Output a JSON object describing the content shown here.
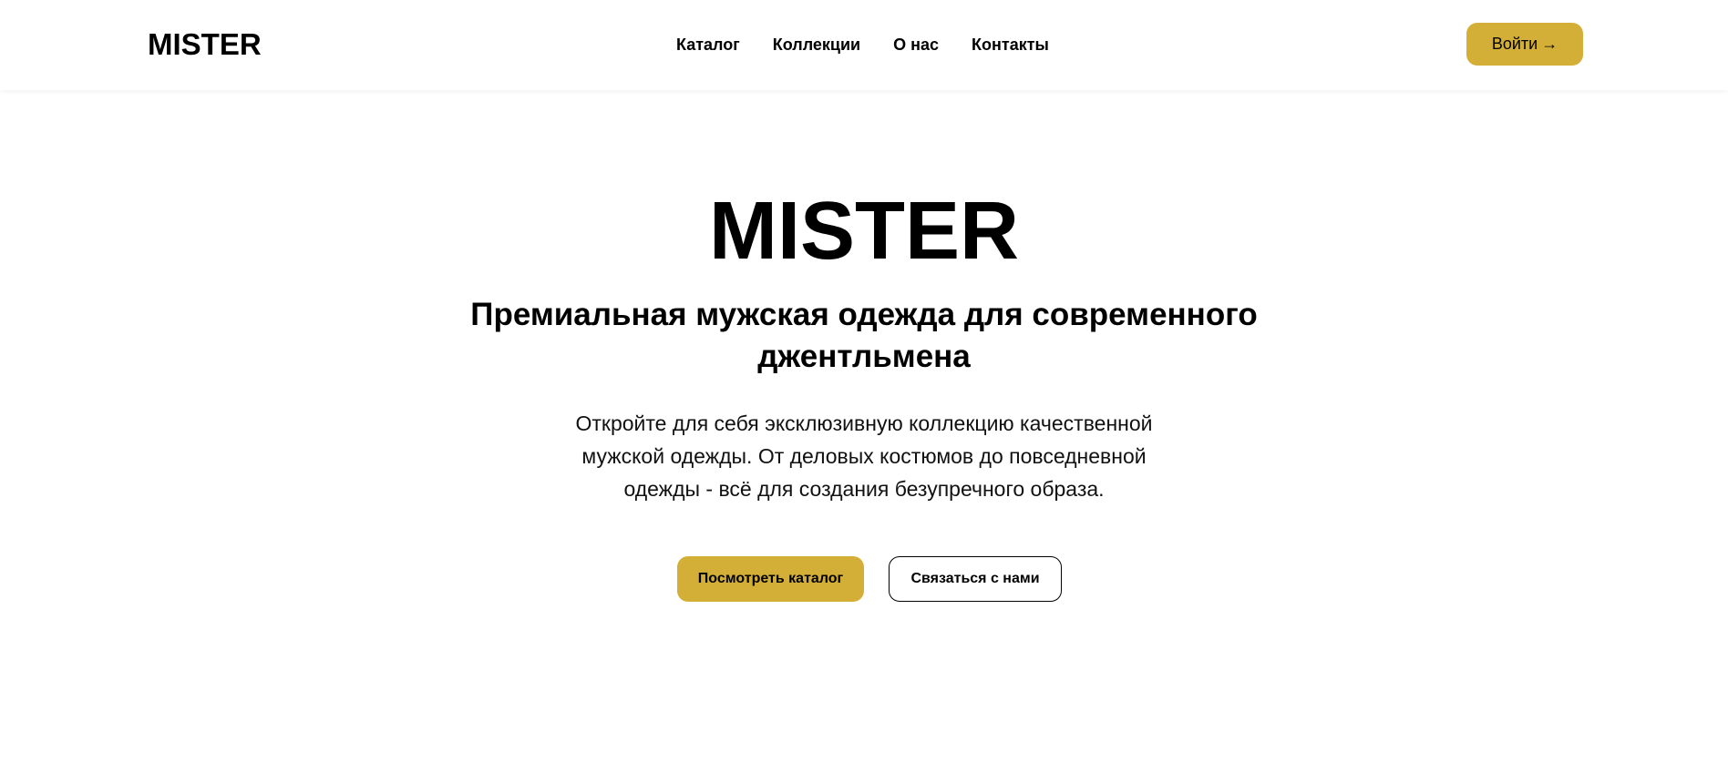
{
  "header": {
    "logo": "MISTER",
    "nav": {
      "catalog": "Каталог",
      "collections": "Коллекции",
      "about": "О нас",
      "contacts": "Контакты"
    },
    "login_label": "Войти",
    "login_arrow": "→"
  },
  "hero": {
    "title": "MISTER",
    "subtitle": "Премиальная мужская одежда для современного джентльмена",
    "description": "Откройте для себя эксклюзивную коллекцию качественной мужской одежды. От деловых костюмов до повседневной одежды - всё для создания безупречного образа.",
    "primary_button": "Посмотреть каталог",
    "secondary_button": "Связаться с нами"
  },
  "colors": {
    "accent": "#D4AF37",
    "text": "#000000",
    "background": "#FFFFFF"
  }
}
